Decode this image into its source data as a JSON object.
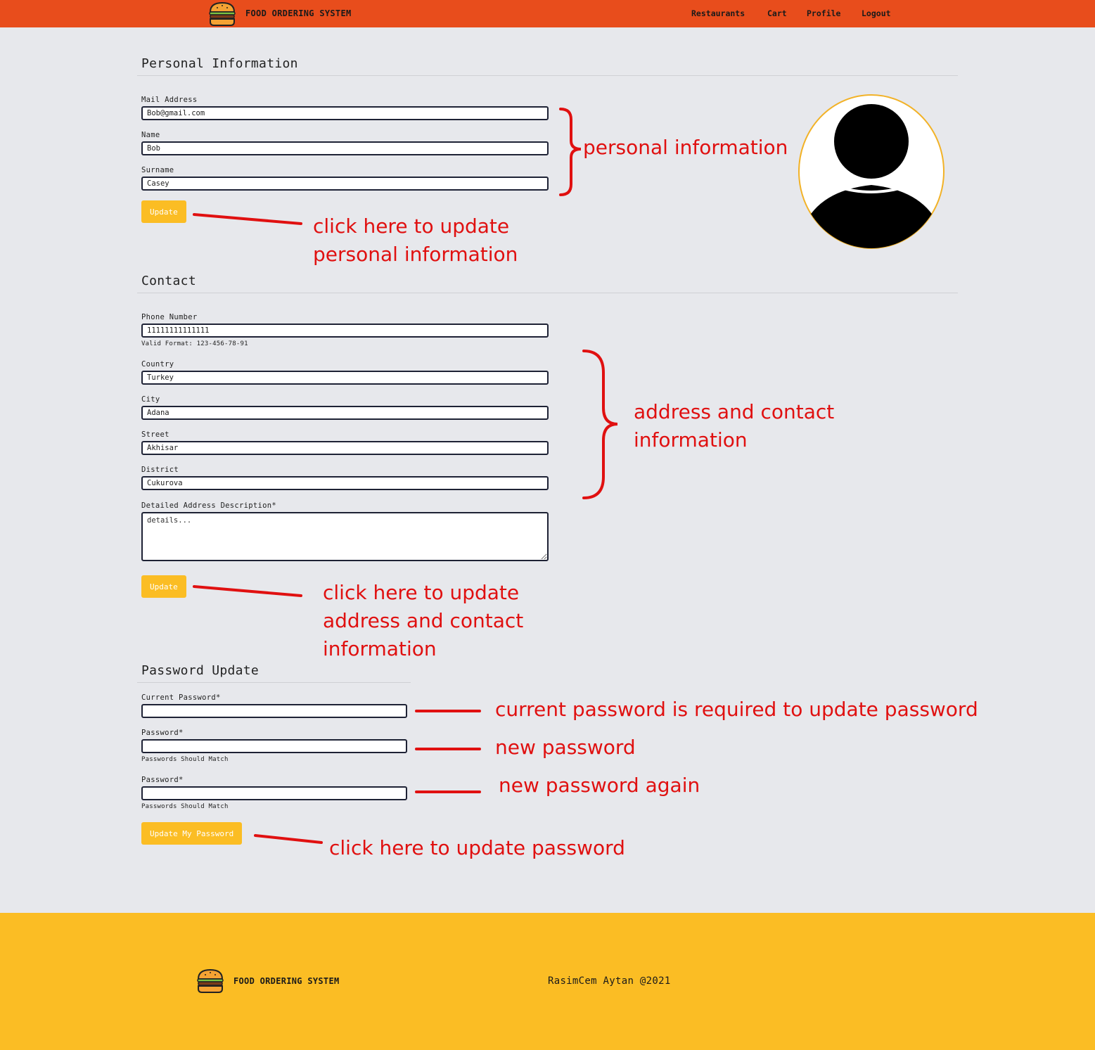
{
  "header": {
    "brand": "FOOD ORDERING SYSTEM",
    "nav": [
      "Restaurants",
      "Cart",
      "Profile",
      "Logout"
    ]
  },
  "personal": {
    "title": "Personal Information",
    "mail_label": "Mail Address",
    "mail_value": "Bob@gmail.com",
    "name_label": "Name",
    "name_value": "Bob",
    "surname_label": "Surname",
    "surname_value": "Casey",
    "update_label": "Update"
  },
  "contact": {
    "title": "Contact",
    "phone_label": "Phone Number",
    "phone_value": "11111111111111",
    "phone_hint": "Valid Format: 123-456-78-91",
    "country_label": "Country",
    "country_value": "Turkey",
    "city_label": "City",
    "city_value": "Adana",
    "street_label": "Street",
    "street_value": "Akhisar",
    "district_label": "District",
    "district_value": "Cukurova",
    "details_label": "Detailed Address Description*",
    "details_placeholder": "details...",
    "update_label": "Update"
  },
  "password": {
    "title": "Password Update",
    "current_label": "Current Password*",
    "new_label": "Password*",
    "new_hint": "Passwords Should Match",
    "again_label": "Password*",
    "again_hint": "Passwords Should Match",
    "update_label": "Update My Password"
  },
  "annotations": {
    "personal_info": "personal information",
    "update_personal_1": "click here to update",
    "update_personal_2": "personal information",
    "address_1": "address and contact",
    "address_2": "information",
    "update_address_1": "click here to update",
    "update_address_2": "address and contact",
    "update_address_3": "information",
    "current_pw": "current password is required to update password",
    "new_pw": "new password",
    "new_pw_again": "new password again",
    "update_pw": "click here to update password"
  },
  "footer": {
    "brand": "FOOD ORDERING SYSTEM",
    "copyright": "RasimCem Aytan @2021"
  },
  "colors": {
    "navbar": "#e84d1c",
    "accent": "#fbbd24",
    "annotation": "#e01010",
    "background": "#e7e8ec"
  },
  "icons": {
    "logo": "burger-icon",
    "avatar": "user-silhouette-icon"
  }
}
